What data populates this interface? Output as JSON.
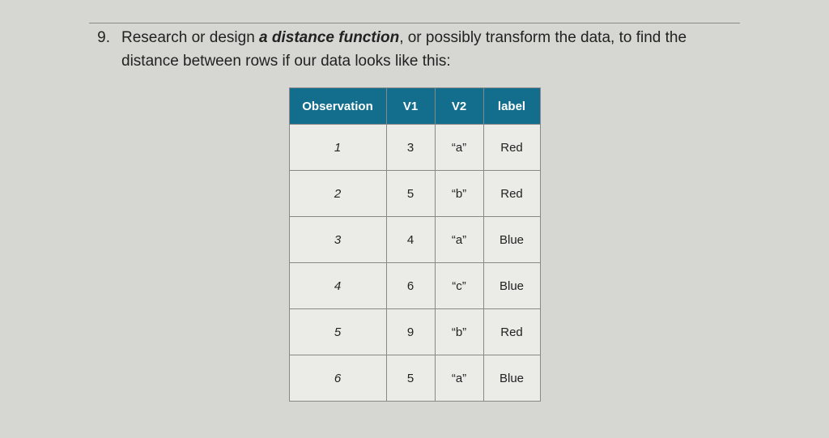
{
  "question": {
    "number": "9.",
    "text_before_em": "Research or design ",
    "em": "a distance function",
    "text_after_em": ", or possibly transform the data, to find the distance between rows if our data looks like this:"
  },
  "table": {
    "headers": {
      "observation": "Observation",
      "v1": "V1",
      "v2": "V2",
      "label": "label"
    },
    "rows": [
      {
        "obs": "1",
        "v1": "3",
        "v2": "“a”",
        "label": "Red"
      },
      {
        "obs": "2",
        "v1": "5",
        "v2": "“b”",
        "label": "Red"
      },
      {
        "obs": "3",
        "v1": "4",
        "v2": "“a”",
        "label": "Blue"
      },
      {
        "obs": "4",
        "v1": "6",
        "v2": "“c”",
        "label": "Blue"
      },
      {
        "obs": "5",
        "v1": "9",
        "v2": "“b”",
        "label": "Red"
      },
      {
        "obs": "6",
        "v1": "5",
        "v2": "“a”",
        "label": "Blue"
      }
    ]
  }
}
